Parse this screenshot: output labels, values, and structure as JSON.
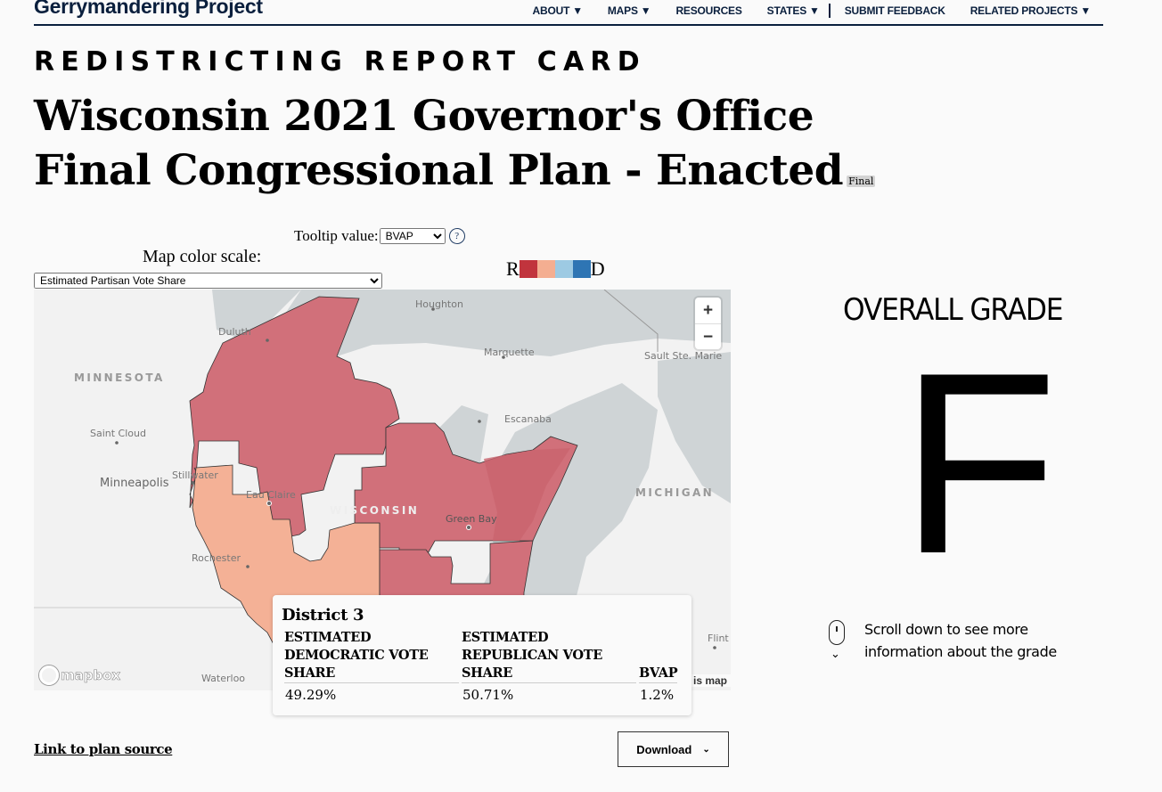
{
  "header": {
    "brand": "Gerrymandering Project",
    "nav": [
      {
        "label": "ABOUT",
        "caret": "▼"
      },
      {
        "label": "MAPS",
        "caret": "▼"
      },
      {
        "label": "RESOURCES",
        "caret": ""
      },
      {
        "label": "STATES",
        "caret": "▼"
      },
      {
        "label": "SUBMIT FEEDBACK",
        "caret": ""
      },
      {
        "label": "RELATED PROJECTS",
        "caret": "▼"
      }
    ]
  },
  "page": {
    "kicker": "REDISTRICTING REPORT CARD",
    "title": "Wisconsin 2021 Governor's Office Final Congressional Plan - Enacted",
    "badge": "Final"
  },
  "controls": {
    "tooltip_label": "Tooltip value:",
    "tooltip_value": "BVAP",
    "help": "?",
    "scale_label": "Map color scale:",
    "scale_value": "Estimated Partisan Vote Share",
    "legend_left": "R",
    "legend_right": "D",
    "legend_colors": [
      "#c1343d",
      "#f4ae91",
      "#9dcae3",
      "#2e75b4"
    ]
  },
  "map": {
    "labels": {
      "houghton": "Houghton",
      "duluth": "Duluth",
      "marquette": "Marquette",
      "sault": "Sault Ste. Marie",
      "minnesota": "MINNESOTA",
      "saint_cloud": "Saint Cloud",
      "escanaba": "Escanaba",
      "stillwater": "Stillwater",
      "minneapolis": "Minneapolis",
      "eau_claire": "Eau Claire",
      "wisconsin": "WISCONSIN",
      "green_bay": "Green Bay",
      "michigan": "MICHIGAN",
      "rochester": "Rochester",
      "flint": "Flint",
      "waterloo": "Waterloo"
    },
    "zoom_in": "+",
    "zoom_out": "−",
    "logo": "mapbox",
    "improve": "is map",
    "district_colors": {
      "red": "#d1707a",
      "light": "#f4b196"
    }
  },
  "tooltip": {
    "title": "District 3",
    "headers": [
      "ESTIMATED DEMOCRATIC VOTE SHARE",
      "ESTIMATED REPUBLICAN VOTE SHARE",
      "BVAP"
    ],
    "values": [
      "49.29%",
      "50.71%",
      "1.2%"
    ]
  },
  "grade": {
    "label": "OVERALL GRADE",
    "value": "F",
    "scroll_hint": "Scroll down to see more information about the grade"
  },
  "footer": {
    "plan_link": "Link to plan source",
    "download": "Download"
  }
}
